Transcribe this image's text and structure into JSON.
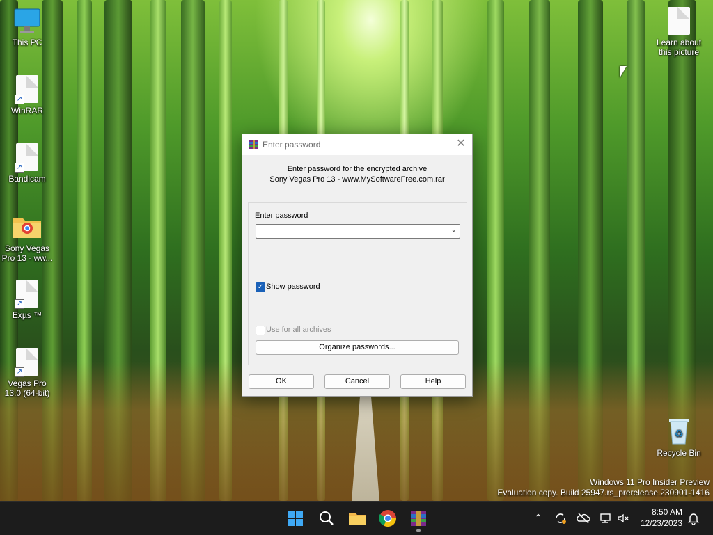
{
  "desktop": {
    "icons": [
      {
        "label": "This PC",
        "type": "monitor"
      },
      {
        "label": "WinRAR",
        "type": "file-shortcut"
      },
      {
        "label": "Bandicam",
        "type": "file-shortcut"
      },
      {
        "label": "Sony Vegas Pro 13 - ww...",
        "type": "folder-chrome"
      },
      {
        "label": "Exµs ™",
        "type": "file-shortcut"
      },
      {
        "label": "Vegas Pro 13.0 (64-bit)",
        "type": "file-shortcut"
      },
      {
        "label": "Learn about this picture",
        "type": "file"
      },
      {
        "label": "Recycle Bin",
        "type": "recycle-bin"
      }
    ],
    "watermark": {
      "line1": "Windows 11 Pro Insider Preview",
      "line2": "Evaluation copy. Build 25947.rs_prerelease.230901-1416"
    }
  },
  "dialog": {
    "title": "Enter password",
    "close_glyph": "✕",
    "message_line1": "Enter password for the encrypted archive",
    "message_line2": "Sony Vegas Pro 13 - www.MySoftwareFree.com.rar",
    "password_label": "Enter password",
    "password_value": "",
    "show_password_label": "Show password",
    "show_password_checked": true,
    "use_for_all_label": "Use for all archives",
    "use_for_all_checked": false,
    "organize_label": "Organize passwords...",
    "ok_label": "OK",
    "cancel_label": "Cancel",
    "help_label": "Help"
  },
  "taskbar": {
    "apps": [
      "start-icon",
      "search-icon",
      "file-explorer-icon",
      "chrome-icon",
      "winrar-icon"
    ],
    "tray_chevron": "⌃",
    "time": "8:50 AM",
    "date": "12/23/2023"
  },
  "colors": {
    "accent": "#1a61b8",
    "taskbar": "#1c1c1c"
  }
}
